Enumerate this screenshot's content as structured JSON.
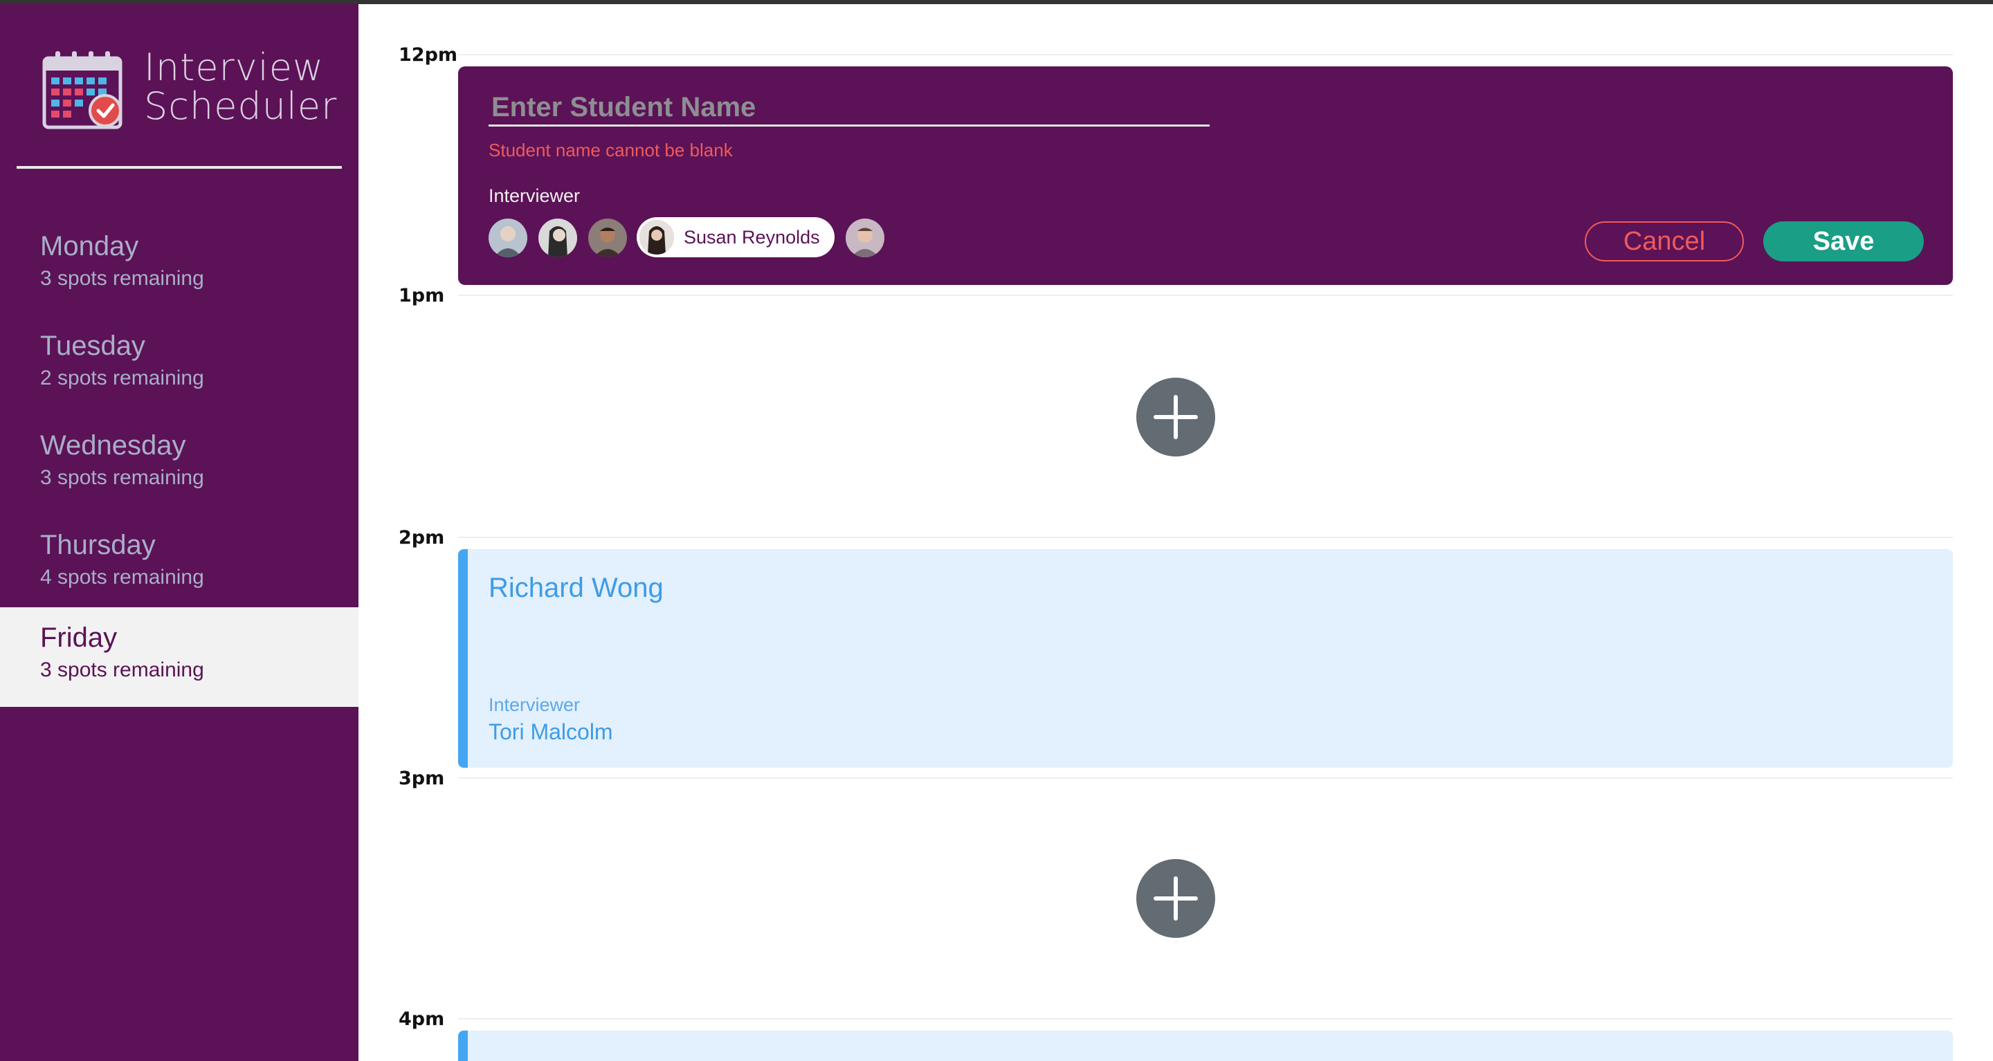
{
  "app": {
    "title_line1": "Interview",
    "title_line2": "Scheduler"
  },
  "sidebar": {
    "days": [
      {
        "name": "Monday",
        "spots": "3 spots remaining",
        "selected": false
      },
      {
        "name": "Tuesday",
        "spots": "2 spots remaining",
        "selected": false
      },
      {
        "name": "Wednesday",
        "spots": "3 spots remaining",
        "selected": false
      },
      {
        "name": "Thursday",
        "spots": "4 spots remaining",
        "selected": false
      },
      {
        "name": "Friday",
        "spots": "3 spots remaining",
        "selected": true
      }
    ]
  },
  "schedule": {
    "times": [
      "12pm",
      "1pm",
      "2pm",
      "3pm",
      "4pm"
    ],
    "form": {
      "placeholder": "Enter Student Name",
      "value": "",
      "error": "Student name cannot be blank",
      "interviewer_label": "Interviewer",
      "selected_interviewer": "Susan Reynolds",
      "cancel_label": "Cancel",
      "save_label": "Save"
    },
    "appointment": {
      "student": "Richard Wong",
      "interviewer_label": "Interviewer",
      "interviewer": "Tori Malcolm"
    }
  },
  "colors": {
    "sidebar": "#5c1257",
    "accent_blue": "#44a6f2",
    "save": "#1a9e86",
    "error": "#f05a5a",
    "add_button": "#636b73"
  },
  "icons": {
    "logo": "calendar-check-icon",
    "add": "plus-icon"
  }
}
